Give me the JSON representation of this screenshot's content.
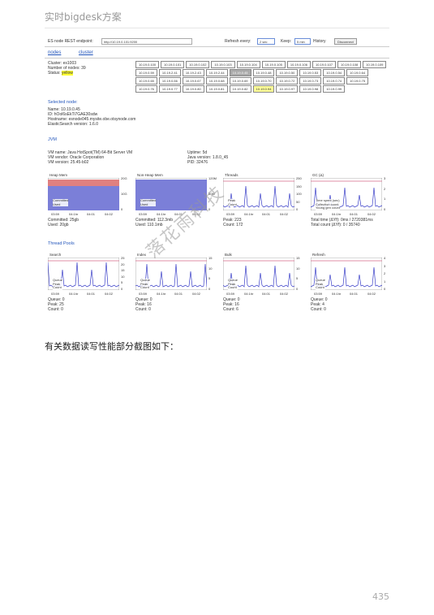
{
  "header": {
    "title": "实时bigdesk方案"
  },
  "screenshot": {
    "endpoint_label": "ES node REST endpoint:",
    "endpoint_value": "http://10.19.0.101:9200",
    "refresh_label": "Refresh every:",
    "refresh_value": "2 sec",
    "keep_label": "Keep:",
    "keep_value": "5 min",
    "history_label": "History",
    "disconnect_label": "Disconnect",
    "tabs": [
      "nodes",
      "cluster"
    ],
    "cluster": {
      "name": "Cluster: es1003",
      "nodes": "Number of nodes: 39",
      "status_label": "Status:",
      "status_value": "yellow"
    },
    "node_list": [
      "10.19.0.100",
      "10.19.0.101",
      "10.19.0.102",
      "10.19.0.103",
      "10.19.0.104",
      "10.19.0.105",
      "10.19.0.106",
      "10.19.0.107",
      "10.19.0.108",
      "10.19.0.109",
      "10.19.0.59",
      "10.19.2.41",
      "10.19.2.43",
      "10.19.2.44",
      "10.19.0.45",
      "10.19.0.48",
      "10.19.0.50",
      "10.19.0.53",
      "10.19.0.54",
      "10.19.0.64",
      "10.19.0.65",
      "10.19.0.66",
      "10.19.0.67",
      "10.19.0.68",
      "10.19.0.69",
      "10.19.0.70",
      "10.19.0.72",
      "10.19.0.73",
      "10.19.0.74",
      "10.19.0.75",
      "10.19.0.76",
      "10.19.0.77",
      "10.19.0.80",
      "10.19.0.81",
      "10.19.0.82",
      "10.19.0.94",
      "10.19.0.97",
      "10.19.0.98",
      "10.19.0.99"
    ],
    "selected_node": {
      "title": "Selected node:",
      "lines": [
        "Name: 10.19.0.45",
        "ID: hOol6sEkTi7GAE30sdw",
        "Hostname: esnode045.mysite.obe.otsynode.com",
        "ElasticSearch version: 1.6.0"
      ]
    },
    "jvm": {
      "title": "JVM",
      "left": [
        "VM name: Java HotSpot(TM) 64-Bit Server VM",
        "VM vendor: Oracle Corporation",
        "VM version: 25.45-b02"
      ],
      "right": [
        "Uptime: 5d",
        "Java version: 1.8.0_45",
        "PID: 32476"
      ]
    },
    "jvm_charts": [
      {
        "title": "Heap Mem",
        "ticks": [
          "20G",
          "10G",
          "0"
        ],
        "x": [
          "03:59",
          "04:1hr",
          "04:01",
          "04:02"
        ],
        "legend": [
          "Committed",
          "Used"
        ],
        "stats": [
          "Committed: 25gb",
          "Used: 20gb"
        ]
      },
      {
        "title": "Non-Heap Mem",
        "ticks": [
          "120M",
          "80M",
          "0"
        ],
        "x": [
          "03:59",
          "04:1hr",
          "04:01",
          "04:02"
        ],
        "legend": [
          "Committed",
          "Used"
        ],
        "stats": [
          "Committed: 112.3mb",
          "Used: 110.1mb"
        ]
      },
      {
        "title": "Threads",
        "ticks": [
          "250",
          "150",
          "100",
          "50",
          "0"
        ],
        "x": [
          "03:59",
          "04:1hr",
          "04:01",
          "04:02"
        ],
        "legend": [
          "Peak",
          "Count"
        ],
        "stats": [
          "Peak: 223",
          "Count: 172"
        ]
      },
      {
        "title": "GC (Δ)",
        "ticks": [
          "3",
          "2",
          "1",
          "0"
        ],
        "x": [
          "03:59",
          "04:1hr",
          "04:01",
          "04:02"
        ],
        "legend": [
          "Time spent (sec)",
          "Collection count",
          "Young gen count"
        ],
        "stats": [
          "Total time (ΔYf): 0ms / 2720381ms",
          "Total count (ΔYf): 0 / 35740"
        ]
      }
    ],
    "thread_pools": {
      "title": "Thread Pools"
    },
    "pool_charts": [
      {
        "title": "Search",
        "ticks": [
          "25",
          "20",
          "15",
          "10",
          "5",
          "0"
        ],
        "x": [
          "03:59",
          "04:1hr",
          "04:01",
          "04:02"
        ],
        "legend": [
          "Queue",
          "Peak",
          "Count"
        ],
        "stats": [
          "Queue: 0",
          "Peak: 25",
          "Count: 0"
        ]
      },
      {
        "title": "Index",
        "ticks": [
          "15",
          "10",
          "5",
          "0"
        ],
        "x": [
          "03:59",
          "04:1hr",
          "04:01",
          "04:02"
        ],
        "legend": [
          "Queue",
          "Peak",
          "Count"
        ],
        "stats": [
          "Queue: 0",
          "Peak: 16",
          "Count: 0"
        ]
      },
      {
        "title": "Bulk",
        "ticks": [
          "15",
          "10",
          "5",
          "0"
        ],
        "x": [
          "03:59",
          "04:1hr",
          "04:01",
          "04:02"
        ],
        "legend": [
          "Queue",
          "Peak",
          "Count"
        ],
        "stats": [
          "Queue: 0",
          "Peak: 16",
          "Count: 6"
        ]
      },
      {
        "title": "Refresh",
        "ticks": [
          "4",
          "3",
          "2",
          "1",
          "0"
        ],
        "x": [
          "03:59",
          "04:1hr",
          "04:01",
          "04:02"
        ],
        "legend": [
          "Queue",
          "Peak",
          "Count"
        ],
        "stats": [
          "Queue: 0",
          "Peak: 4",
          "Count: 0"
        ]
      }
    ]
  },
  "body": {
    "text": "有关数据读写性能部分截图如下："
  },
  "watermark": "落花雨科技",
  "page_number": "435"
}
